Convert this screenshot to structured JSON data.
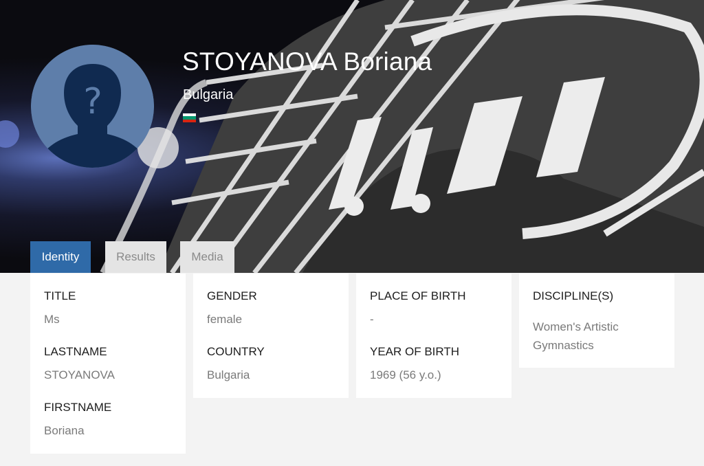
{
  "athlete": {
    "name": "STOYANOVA Boriana",
    "country": "Bulgaria",
    "flag_colors": [
      "#ffffff",
      "#00966e",
      "#d62612"
    ]
  },
  "tabs": [
    {
      "label": "Identity",
      "active": true
    },
    {
      "label": "Results",
      "active": false
    },
    {
      "label": "Media",
      "active": false
    }
  ],
  "identity": {
    "title": {
      "label": "TITLE",
      "value": "Ms"
    },
    "lastname": {
      "label": "LASTNAME",
      "value": "STOYANOVA"
    },
    "firstname": {
      "label": "FIRSTNAME",
      "value": "Boriana"
    },
    "gender": {
      "label": "GENDER",
      "value": "female"
    },
    "country": {
      "label": "COUNTRY",
      "value": "Bulgaria"
    },
    "place_of_birth": {
      "label": "PLACE OF BIRTH",
      "value": "-"
    },
    "year_of_birth": {
      "label": "YEAR OF BIRTH",
      "value": "1969 (56 y.o.)"
    },
    "disciplines": {
      "label": "DISCIPLINE(S)",
      "value": "Women's Artistic Gymnastics"
    }
  },
  "colors": {
    "accent": "#2f6aa8",
    "avatar_bg": "#5e7eaa",
    "avatar_silhouette": "#102a50"
  },
  "icons": {
    "avatar": "unknown-person-icon",
    "flag": "bulgaria-flag-icon"
  }
}
